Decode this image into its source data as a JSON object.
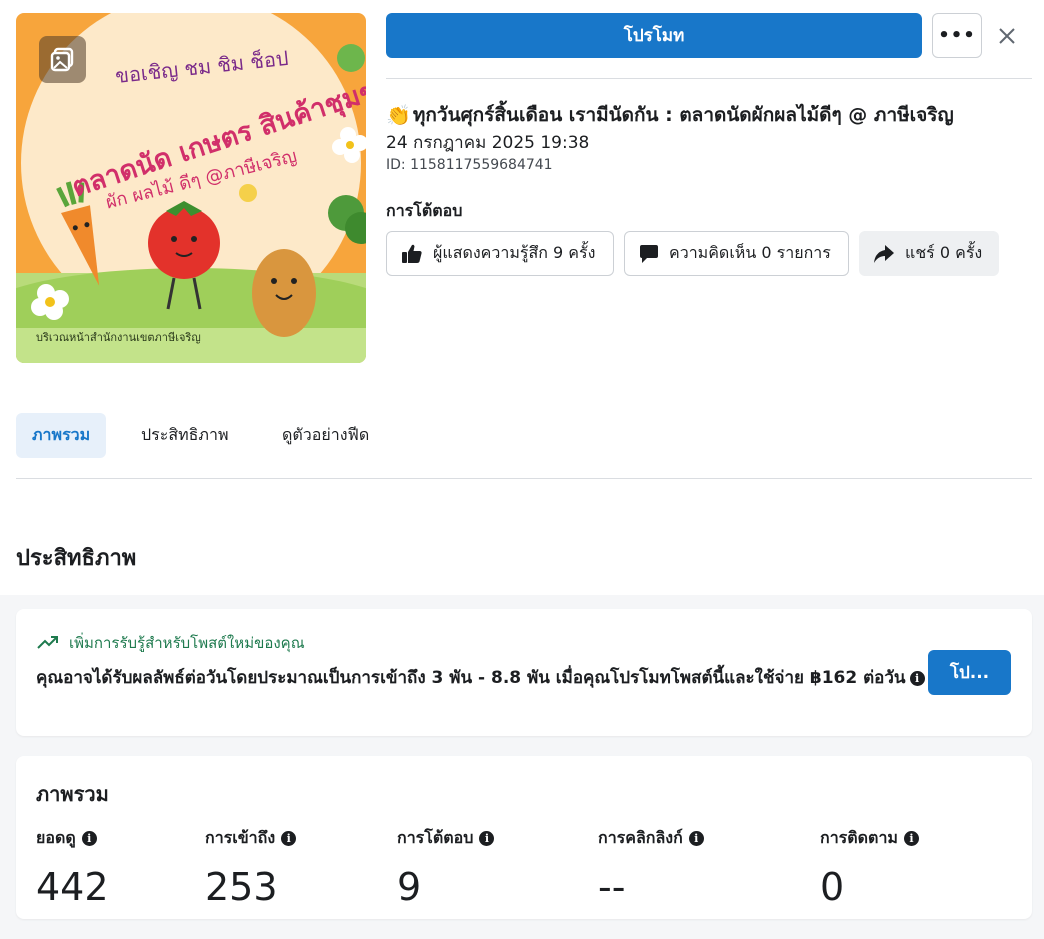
{
  "thumbnail": {
    "alt_lines": [
      "ขอเชิญ ชม ชิม ช็อป",
      "ตลาดนัด เกษตร สินค้าชุมชน",
      "ผัก ผลไม้ ดีๆ @ภาษีเจริญ",
      "บริเวณหน้าสำนักงานเขตภาษีเจริญ"
    ],
    "badge_icon": "photo-album-icon"
  },
  "header": {
    "promote_label": "โปรโมท",
    "more_label": "•••",
    "close_icon": "close-icon"
  },
  "post": {
    "emoji": "👏",
    "title": "ทุกวันศุกร์สิ้นเดือน เรามีนัดกัน : ตลาดนัดผักผลไม้ดีๆ @ ภาษีเจริญ",
    "date": "24 กรกฎาคม 2025 19:38",
    "id": "ID: 1158117559684741",
    "engagement_label": "การโต้ตอบ"
  },
  "chips": {
    "reactions": "ผู้แสดงความรู้สึก 9 ครั้ง",
    "comments": "ความคิดเห็น 0 รายการ",
    "shares": "แชร์ 0 ครั้ง"
  },
  "tabs": {
    "overview": "ภาพรวม",
    "performance": "ประสิทธิภาพ",
    "preview": "ดูตัวอย่างฟีด"
  },
  "section_title": "ประสิทธิภาพ",
  "suggestion": {
    "headline": "เพิ่มการรับรู้สำหรับโพสต์ใหม่ของคุณ",
    "body": "คุณอาจได้รับผลลัพธ์ต่อวันโดยประมาณเป็นการเข้าถึง 3 พัน - 8.8 พัน เมื่อคุณโปรโมทโพสต์นี้และใช้จ่าย ฿162 ต่อวัน",
    "button_label": "โป...",
    "accent_color": "#1e7a4e"
  },
  "overview": {
    "title": "ภาพรวม",
    "metrics": [
      {
        "label": "ยอดดู",
        "value": "442"
      },
      {
        "label": "การเข้าถึง",
        "value": "253"
      },
      {
        "label": "การโต้ตอบ",
        "value": "9"
      },
      {
        "label": "การคลิกลิงก์",
        "value": "--"
      },
      {
        "label": "การติดตาม",
        "value": "0"
      }
    ]
  },
  "colors": {
    "primary": "#1877c9",
    "text": "#1c1e21",
    "divider": "#dadde1"
  }
}
